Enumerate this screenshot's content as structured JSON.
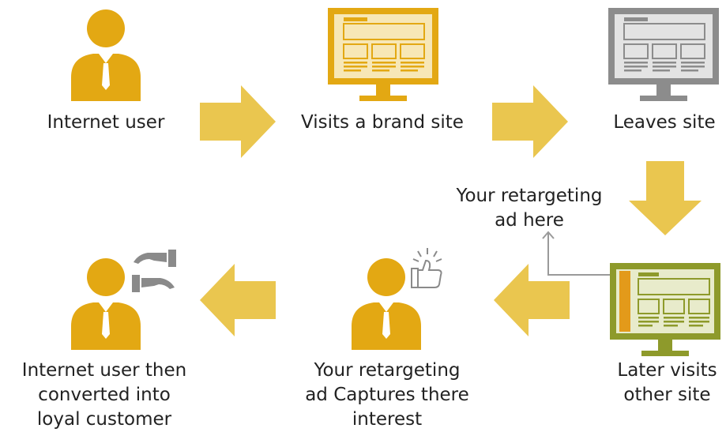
{
  "steps": {
    "step1": {
      "label": "Internet user",
      "icon": "person-icon"
    },
    "step2": {
      "label": "Visits a brand site",
      "icon": "monitor-brand-icon"
    },
    "step3": {
      "label": "Leaves site",
      "icon": "monitor-grey-icon"
    },
    "step4": {
      "line1": "Later visits",
      "line2": "other site",
      "icon": "monitor-other-site-icon"
    },
    "step5": {
      "line1": "Your retargeting",
      "line2": "ad Captures there",
      "line3": "interest",
      "icon": "person-thumbs-up-icon"
    },
    "step6": {
      "line1": "Internet user then",
      "line2": "converted into",
      "line3": "loyal customer",
      "icon": "person-handshake-icon"
    }
  },
  "callout": {
    "line1": "Your retargeting",
    "line2": "ad here"
  },
  "colors": {
    "gold": "#E3A813",
    "arrow": "#EAC64F",
    "monitor_grey": "#8C8C8C",
    "monitor_olive": "#8E9A2B",
    "icon_grey": "#8A8A8A",
    "ad_orange": "#E39A1A"
  }
}
